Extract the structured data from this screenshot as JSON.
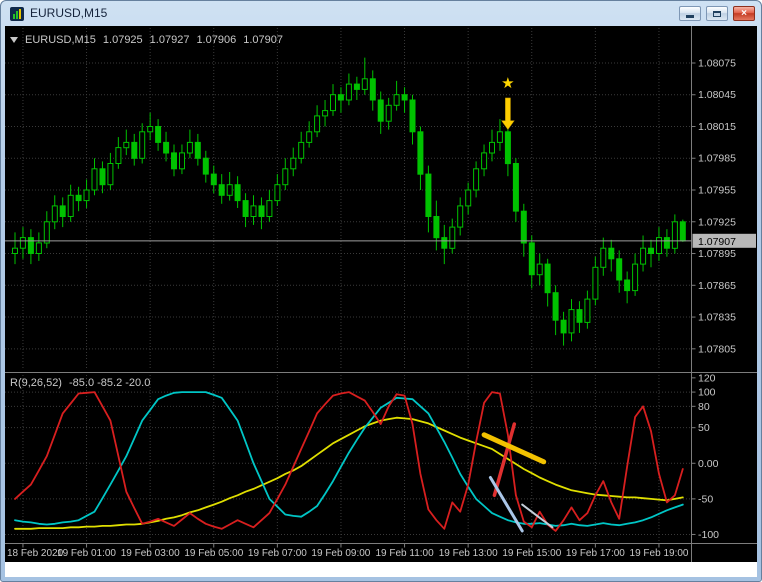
{
  "window": {
    "title": "EURUSD,M15",
    "close_glyph": "×"
  },
  "header": {
    "symbol": "EURUSD,M15",
    "open": "1.07925",
    "high": "1.07927",
    "low": "1.07906",
    "close": "1.07907"
  },
  "indicator_header": {
    "name": "R(9,26,52)",
    "values": "-85.0 -85.2 -20.0"
  },
  "chart_data": {
    "type": "candlestick",
    "symbol": "EURUSD",
    "timeframe": "M15",
    "current_price": 1.07907,
    "price_axis_labels": [
      1.08075,
      1.08045,
      1.08015,
      1.07985,
      1.07955,
      1.07925,
      1.07895,
      1.07865,
      1.07835,
      1.07805
    ],
    "time_labels": [
      {
        "index": 1,
        "text": "18 Feb 2020"
      },
      {
        "index": 9,
        "text": "19 Feb 01:00"
      },
      {
        "index": 17,
        "text": "19 Feb 03:00"
      },
      {
        "index": 25,
        "text": "19 Feb 05:00"
      },
      {
        "index": 33,
        "text": "19 Feb 07:00"
      },
      {
        "index": 41,
        "text": "19 Feb 09:00"
      },
      {
        "index": 49,
        "text": "19 Feb 11:00"
      },
      {
        "index": 57,
        "text": "19 Feb 13:00"
      },
      {
        "index": 65,
        "text": "19 Feb 15:00"
      },
      {
        "index": 73,
        "text": "19 Feb 17:00"
      },
      {
        "index": 81,
        "text": "19 Feb 19:00"
      }
    ],
    "candles": [
      [
        1.07895,
        1.07915,
        1.07885,
        1.079
      ],
      [
        1.079,
        1.0792,
        1.0789,
        1.0791
      ],
      [
        1.0791,
        1.07918,
        1.07885,
        1.07895
      ],
      [
        1.07895,
        1.07915,
        1.07888,
        1.07905
      ],
      [
        1.07905,
        1.07935,
        1.079,
        1.07925
      ],
      [
        1.07925,
        1.0795,
        1.07918,
        1.0794
      ],
      [
        1.0794,
        1.07948,
        1.0792,
        1.0793
      ],
      [
        1.0793,
        1.0796,
        1.07925,
        1.0795
      ],
      [
        1.0795,
        1.07958,
        1.07935,
        1.07945
      ],
      [
        1.07945,
        1.07965,
        1.07938,
        1.07955
      ],
      [
        1.07955,
        1.07985,
        1.0795,
        1.07975
      ],
      [
        1.07975,
        1.07982,
        1.07952,
        1.0796
      ],
      [
        1.0796,
        1.0799,
        1.07955,
        1.0798
      ],
      [
        1.0798,
        1.08005,
        1.07975,
        1.07995
      ],
      [
        1.07995,
        1.08012,
        1.07988,
        1.08
      ],
      [
        1.08,
        1.08008,
        1.07978,
        1.07985
      ],
      [
        1.07985,
        1.08018,
        1.0798,
        1.0801
      ],
      [
        1.0801,
        1.08028,
        1.08002,
        1.08015
      ],
      [
        1.08015,
        1.08022,
        1.07992,
        1.08
      ],
      [
        1.08,
        1.0801,
        1.07982,
        1.0799
      ],
      [
        1.0799,
        1.07998,
        1.07968,
        1.07975
      ],
      [
        1.07975,
        1.07998,
        1.0797,
        1.0799
      ],
      [
        1.0799,
        1.08012,
        1.07985,
        1.08
      ],
      [
        1.08,
        1.08008,
        1.07978,
        1.07985
      ],
      [
        1.07985,
        1.07992,
        1.07962,
        1.0797
      ],
      [
        1.0797,
        1.07978,
        1.07952,
        1.0796
      ],
      [
        1.0796,
        1.0797,
        1.07942,
        1.0795
      ],
      [
        1.0795,
        1.07972,
        1.07945,
        1.0796
      ],
      [
        1.0796,
        1.07968,
        1.07938,
        1.07945
      ],
      [
        1.07945,
        1.07952,
        1.0792,
        1.0793
      ],
      [
        1.0793,
        1.0795,
        1.07922,
        1.0794
      ],
      [
        1.0794,
        1.07948,
        1.07918,
        1.0793
      ],
      [
        1.0793,
        1.07955,
        1.07925,
        1.07945
      ],
      [
        1.07945,
        1.0797,
        1.0794,
        1.0796
      ],
      [
        1.0796,
        1.07985,
        1.07955,
        1.07975
      ],
      [
        1.07975,
        1.07995,
        1.07968,
        1.07985
      ],
      [
        1.07985,
        1.0801,
        1.0798,
        1.08
      ],
      [
        1.08,
        1.0802,
        1.07995,
        1.0801
      ],
      [
        1.0801,
        1.08035,
        1.08005,
        1.08025
      ],
      [
        1.08025,
        1.0804,
        1.08015,
        1.0803
      ],
      [
        1.0803,
        1.08055,
        1.08025,
        1.08045
      ],
      [
        1.08045,
        1.08052,
        1.08028,
        1.0804
      ],
      [
        1.0804,
        1.08065,
        1.08035,
        1.08055
      ],
      [
        1.08055,
        1.08062,
        1.0804,
        1.0805
      ],
      [
        1.0805,
        1.0808,
        1.08045,
        1.0806
      ],
      [
        1.0806,
        1.08068,
        1.0803,
        1.0804
      ],
      [
        1.0804,
        1.08048,
        1.08008,
        1.0802
      ],
      [
        1.0802,
        1.08042,
        1.08012,
        1.08035
      ],
      [
        1.08035,
        1.08058,
        1.0803,
        1.08045
      ],
      [
        1.08045,
        1.08052,
        1.08028,
        1.0804
      ],
      [
        1.0804,
        1.08045,
        1.07998,
        1.0801
      ],
      [
        1.0801,
        1.08015,
        1.07955,
        1.0797
      ],
      [
        1.0797,
        1.07978,
        1.07915,
        1.0793
      ],
      [
        1.0793,
        1.07945,
        1.07898,
        1.0791
      ],
      [
        1.0791,
        1.07922,
        1.07885,
        1.079
      ],
      [
        1.079,
        1.07928,
        1.07895,
        1.0792
      ],
      [
        1.0792,
        1.07948,
        1.07912,
        1.0794
      ],
      [
        1.0794,
        1.07962,
        1.07932,
        1.07955
      ],
      [
        1.07955,
        1.07982,
        1.07948,
        1.07975
      ],
      [
        1.07975,
        1.07998,
        1.07968,
        1.0799
      ],
      [
        1.0799,
        1.08012,
        1.07982,
        1.08
      ],
      [
        1.08,
        1.08022,
        1.07992,
        1.0801
      ],
      [
        1.0801,
        1.08016,
        1.07968,
        1.0798
      ],
      [
        1.0798,
        1.07985,
        1.07925,
        1.07935
      ],
      [
        1.07935,
        1.07942,
        1.07892,
        1.07905
      ],
      [
        1.07905,
        1.07912,
        1.07862,
        1.07875
      ],
      [
        1.07875,
        1.07895,
        1.07865,
        1.07885
      ],
      [
        1.07885,
        1.0789,
        1.07845,
        1.07858
      ],
      [
        1.07858,
        1.07865,
        1.07818,
        1.07832
      ],
      [
        1.07832,
        1.0784,
        1.07808,
        1.0782
      ],
      [
        1.0782,
        1.07852,
        1.07812,
        1.07842
      ],
      [
        1.07842,
        1.0785,
        1.0782,
        1.0783
      ],
      [
        1.0783,
        1.0786,
        1.07824,
        1.07852
      ],
      [
        1.07852,
        1.07892,
        1.07846,
        1.07882
      ],
      [
        1.07882,
        1.0791,
        1.07874,
        1.079
      ],
      [
        1.079,
        1.07908,
        1.07878,
        1.0789
      ],
      [
        1.0789,
        1.07898,
        1.07858,
        1.0787
      ],
      [
        1.0787,
        1.07878,
        1.07848,
        1.0786
      ],
      [
        1.0786,
        1.07895,
        1.07855,
        1.07885
      ],
      [
        1.07885,
        1.07912,
        1.07878,
        1.079
      ],
      [
        1.079,
        1.07908,
        1.07882,
        1.07895
      ],
      [
        1.07895,
        1.0792,
        1.07888,
        1.0791
      ],
      [
        1.0791,
        1.07918,
        1.07892,
        1.079
      ],
      [
        1.079,
        1.07932,
        1.07895,
        1.07925
      ],
      [
        1.07925,
        1.07927,
        1.07906,
        1.07907
      ]
    ],
    "oscillator": {
      "name": "R(9,26,52)",
      "display_values": "-85.0 -85.2 -20.0",
      "axis_labels": [
        {
          "text": "120",
          "value": 120
        },
        {
          "text": "100",
          "value": 100
        },
        {
          "text": "80",
          "value": 80
        },
        {
          "text": "50",
          "value": 50
        },
        {
          "text": "0.00",
          "value": 0
        },
        {
          "text": "-50",
          "value": -50
        },
        {
          "text": "-100",
          "value": -100
        }
      ],
      "grid_levels": [
        100,
        80,
        50,
        0,
        -50,
        -100
      ],
      "series": [
        {
          "name": "fast",
          "color": "#d81f1f",
          "width": 1.8,
          "values": [
            -50,
            -40,
            -30,
            -10,
            10,
            40,
            70,
            84,
            98,
            99,
            100,
            80,
            60,
            10,
            -40,
            -63,
            -85,
            -82,
            -78,
            -83,
            -88,
            -79,
            -70,
            -78,
            -85,
            -89,
            -92,
            -86,
            -80,
            -85,
            -90,
            -80,
            -70,
            -50,
            -30,
            -5,
            20,
            45,
            70,
            83,
            95,
            98,
            100,
            94,
            88,
            72,
            55,
            80,
            97,
            95,
            55,
            -15,
            -65,
            -80,
            -92,
            -55,
            -68,
            -30,
            30,
            85,
            100,
            98,
            40,
            -45,
            -82,
            -90,
            -68,
            -86,
            -95,
            -80,
            -62,
            -80,
            -70,
            -45,
            -25,
            -55,
            -78,
            -5,
            65,
            80,
            45,
            -15,
            -55,
            -45,
            -8
          ]
        },
        {
          "name": "medium",
          "color": "#00c6c6",
          "width": 1.8,
          "values": [
            -80,
            -82,
            -83,
            -85,
            -86,
            -85,
            -83,
            -82,
            -80,
            -74,
            -68,
            -49,
            -30,
            -10,
            10,
            35,
            60,
            75,
            90,
            95,
            99,
            100,
            100,
            100,
            100,
            96,
            92,
            76,
            60,
            30,
            0,
            -25,
            -50,
            -61,
            -72,
            -74,
            -75,
            -68,
            -60,
            -43,
            -25,
            -5,
            15,
            33,
            50,
            64,
            78,
            85,
            92,
            91,
            90,
            80,
            70,
            50,
            30,
            8,
            -15,
            -33,
            -50,
            -60,
            -70,
            -75,
            -80,
            -83,
            -85,
            -85,
            -84,
            -86,
            -88,
            -87,
            -85,
            -87,
            -88,
            -86,
            -84,
            -86,
            -87,
            -85,
            -83,
            -80,
            -76,
            -71,
            -66,
            -62,
            -58
          ]
        },
        {
          "name": "slow",
          "color": "#e0df00",
          "width": 1.8,
          "values": [
            -92,
            -92,
            -92,
            -91,
            -91,
            -91,
            -91,
            -90,
            -90,
            -89,
            -89,
            -88,
            -88,
            -87,
            -86,
            -86,
            -85,
            -83,
            -81,
            -78,
            -76,
            -73,
            -69,
            -66,
            -62,
            -58,
            -54,
            -49,
            -45,
            -40,
            -36,
            -31,
            -26,
            -21,
            -15,
            -10,
            -4,
            4,
            12,
            20,
            28,
            34,
            40,
            46,
            52,
            56,
            60,
            62,
            64,
            63,
            62,
            59,
            56,
            51,
            46,
            41,
            36,
            32,
            28,
            24,
            20,
            13,
            6,
            -1,
            -8,
            -14,
            -20,
            -25,
            -30,
            -34,
            -38,
            -40,
            -42,
            -44,
            -45,
            -46,
            -47,
            -48,
            -48,
            -49,
            -50,
            -51,
            -52,
            -50,
            -48
          ]
        }
      ]
    },
    "annotations": {
      "star": {
        "glyph": "★",
        "index": 62,
        "price": 1.08056,
        "color": "#ffd700"
      },
      "arrow_down": {
        "index": 62,
        "price_top": 1.08042,
        "price_tip": 1.08012,
        "color": "#ffce00"
      },
      "segments": [
        {
          "name": "trend-segment-red",
          "from": [
            60.3,
            -45
          ],
          "to": [
            62.8,
            55
          ],
          "color": "#e03030",
          "width": 3.5
        },
        {
          "name": "trend-segment-gold",
          "from": [
            59.0,
            40
          ],
          "to": [
            66.5,
            2
          ],
          "color": "#f2c200",
          "width": 5
        },
        {
          "name": "trend-segment-lightblue",
          "from": [
            59.8,
            -20
          ],
          "to": [
            63.8,
            -95
          ],
          "color": "#aac6e8",
          "width": 3
        },
        {
          "name": "trend-segment-silver",
          "from": [
            63.8,
            -58
          ],
          "to": [
            67.6,
            -90
          ],
          "color": "#c4cdd8",
          "width": 2
        }
      ]
    },
    "colors": {
      "background": "#000000",
      "grid": "#3a3a3a",
      "candle": "#00c200",
      "axis_text": "#c8c8c8",
      "bid_line": "#9e9e9e",
      "bid_tag_bg": "#b8b8b8",
      "bid_tag_text": "#000000",
      "separator": "#7d7d7d"
    }
  }
}
